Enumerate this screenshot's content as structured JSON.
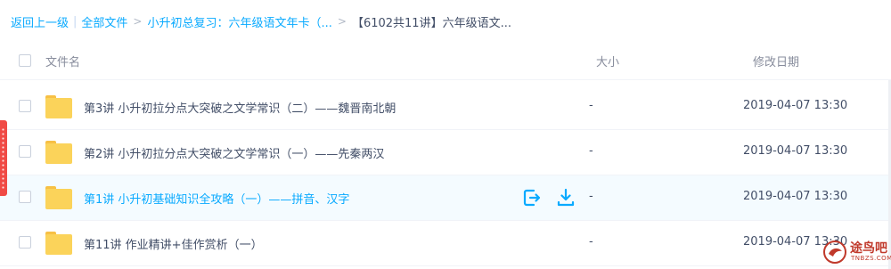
{
  "breadcrumb": {
    "back": "返回上一级",
    "all_files": "全部文件",
    "folder1": "小升初总复习：六年级语文年卡（...",
    "current": "【6102共11讲】六年级语文...",
    "separator": "|",
    "arrow": ">"
  },
  "table": {
    "headers": {
      "name": "文件名",
      "size": "大小",
      "date": "修改日期"
    },
    "rows": [
      {
        "name": "第3讲 小升初拉分点大突破之文学常识（二）——魏晋南北朝",
        "size": "-",
        "date": "2019-04-07 13:30",
        "selected": false
      },
      {
        "name": "第2讲 小升初拉分点大突破之文学常识（一）——先秦两汉",
        "size": "-",
        "date": "2019-04-07 13:30",
        "selected": false
      },
      {
        "name": "第1讲 小升初基础知识全攻略（一）——拼音、汉字",
        "size": "-",
        "date": "2019-04-07 13:30",
        "selected": true
      },
      {
        "name": "第11讲 作业精讲+佳作赏析（一）",
        "size": "-",
        "date": "2019-04-07 13:30",
        "selected": false
      }
    ]
  },
  "row_actions": {
    "share_icon": "share-icon",
    "download_icon": "download-icon"
  },
  "watermark": {
    "text": "途鸟吧",
    "sub": "TNBZS.COM"
  },
  "colors": {
    "accent": "#09aaff",
    "folder": "#fbd35a",
    "text": "#424e67",
    "muted": "#878c9c",
    "side_tab": "#f04a45"
  }
}
